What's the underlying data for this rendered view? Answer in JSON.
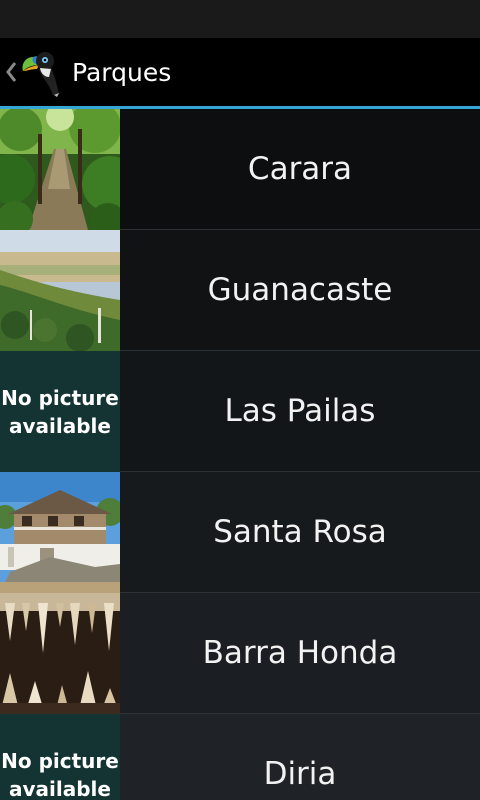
{
  "action_bar": {
    "title": "Parques",
    "up_icon": "chevron-left-icon",
    "app_icon": "toucan-icon"
  },
  "parks": [
    {
      "name": "Carara",
      "has_picture": true,
      "picture": "forest-path-photo"
    },
    {
      "name": "Guanacaste",
      "has_picture": true,
      "picture": "hillside-landscape-photo"
    },
    {
      "name": "Las Pailas",
      "has_picture": false,
      "picture_placeholder": "No picture\navailable"
    },
    {
      "name": "Santa Rosa",
      "has_picture": true,
      "picture": "historic-house-photo"
    },
    {
      "name": "Barra Honda",
      "has_picture": true,
      "picture": "cave-stalactites-photo"
    },
    {
      "name": "Diria",
      "has_picture": false,
      "picture_placeholder": "No picture\navailable"
    }
  ],
  "colors": {
    "status_bar": "#1a1a1a",
    "action_bar": "#000000",
    "accent_divider": "#36a6d6",
    "placeholder_bg": "#143333"
  }
}
